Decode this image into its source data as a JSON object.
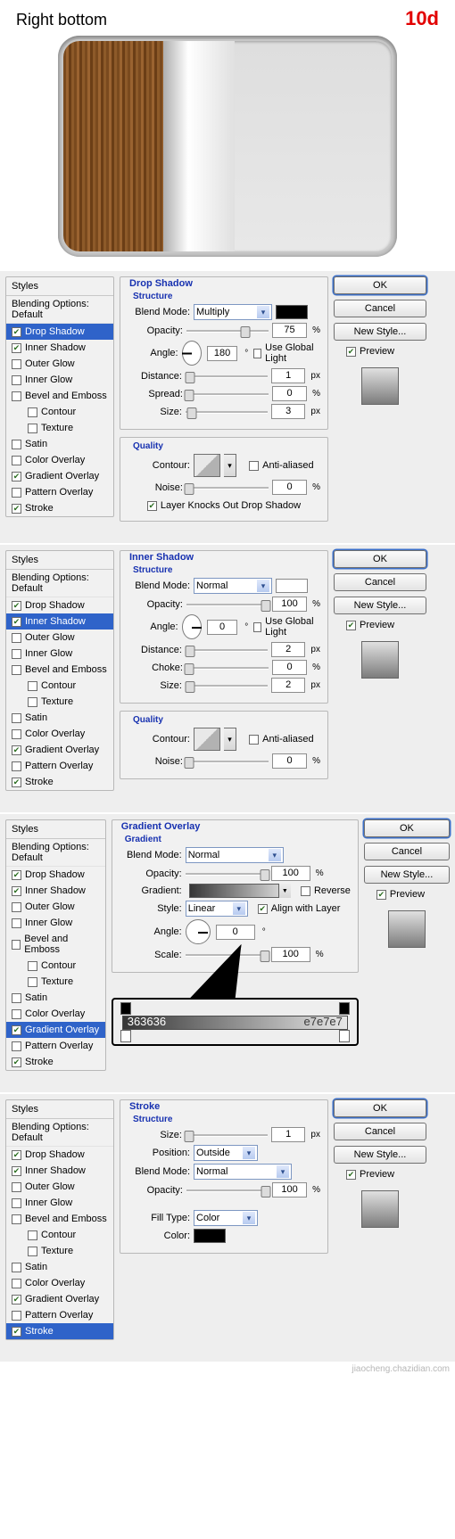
{
  "top": {
    "title": "Right bottom",
    "badge": "10d"
  },
  "common": {
    "styles_header": "Styles",
    "blending_options": "Blending Options: Default",
    "style_items": [
      {
        "label": "Drop Shadow"
      },
      {
        "label": "Inner Shadow"
      },
      {
        "label": "Outer Glow"
      },
      {
        "label": "Inner Glow"
      },
      {
        "label": "Bevel and Emboss"
      },
      {
        "label": "Contour",
        "indent": true
      },
      {
        "label": "Texture",
        "indent": true
      },
      {
        "label": "Satin"
      },
      {
        "label": "Color Overlay"
      },
      {
        "label": "Gradient Overlay"
      },
      {
        "label": "Pattern Overlay"
      },
      {
        "label": "Stroke"
      }
    ],
    "buttons": {
      "ok": "OK",
      "cancel": "Cancel",
      "new_style": "New Style...",
      "preview": "Preview"
    },
    "labels": {
      "structure": "Structure",
      "quality": "Quality",
      "gradient": "Gradient",
      "blend_mode": "Blend Mode:",
      "opacity": "Opacity:",
      "angle": "Angle:",
      "distance": "Distance:",
      "spread": "Spread:",
      "size": "Size:",
      "choke": "Choke:",
      "contour": "Contour:",
      "noise": "Noise:",
      "gradient_lbl": "Gradient:",
      "style": "Style:",
      "scale": "Scale:",
      "position": "Position:",
      "fill_type": "Fill Type:",
      "color": "Color:",
      "anti_aliased": "Anti-aliased",
      "use_global_light": "Use Global Light",
      "layer_knocks": "Layer Knocks Out Drop Shadow",
      "reverse": "Reverse",
      "align_with_layer": "Align with Layer",
      "deg": "°",
      "pct": "%",
      "px": "px"
    }
  },
  "panels": [
    {
      "title": "Drop Shadow",
      "active": "Drop Shadow",
      "checked": [
        "Drop Shadow",
        "Inner Shadow",
        "Gradient Overlay",
        "Stroke"
      ],
      "blend_mode": "Multiply",
      "swatch": "#000000",
      "opacity": "75",
      "angle": "180",
      "use_global": false,
      "distance": "1",
      "spread": "0",
      "size": "3",
      "anti_aliased": false,
      "noise": "0",
      "layer_knocks": true
    },
    {
      "title": "Inner Shadow",
      "active": "Inner Shadow",
      "checked": [
        "Drop Shadow",
        "Inner Shadow",
        "Gradient Overlay",
        "Stroke"
      ],
      "blend_mode": "Normal",
      "swatch": "#ffffff",
      "opacity": "100",
      "angle": "0",
      "use_global": false,
      "distance": "2",
      "choke": "0",
      "size": "2",
      "anti_aliased": false,
      "noise": "0"
    },
    {
      "title": "Gradient Overlay",
      "active": "Gradient Overlay",
      "checked": [
        "Drop Shadow",
        "Inner Shadow",
        "Gradient Overlay",
        "Stroke"
      ],
      "blend_mode": "Normal",
      "opacity": "100",
      "reverse": false,
      "align": true,
      "style": "Linear",
      "angle": "0",
      "scale": "100",
      "gradient_left_hex": "363636",
      "gradient_right_hex": "e7e7e7"
    },
    {
      "title": "Stroke",
      "active": "Stroke",
      "checked": [
        "Drop Shadow",
        "Inner Shadow",
        "Gradient Overlay",
        "Stroke"
      ],
      "size": "1",
      "position": "Outside",
      "blend_mode": "Normal",
      "opacity": "100",
      "fill_type": "Color",
      "color": "#000000"
    }
  ],
  "watermark": "jiaocheng.chazidian.com"
}
